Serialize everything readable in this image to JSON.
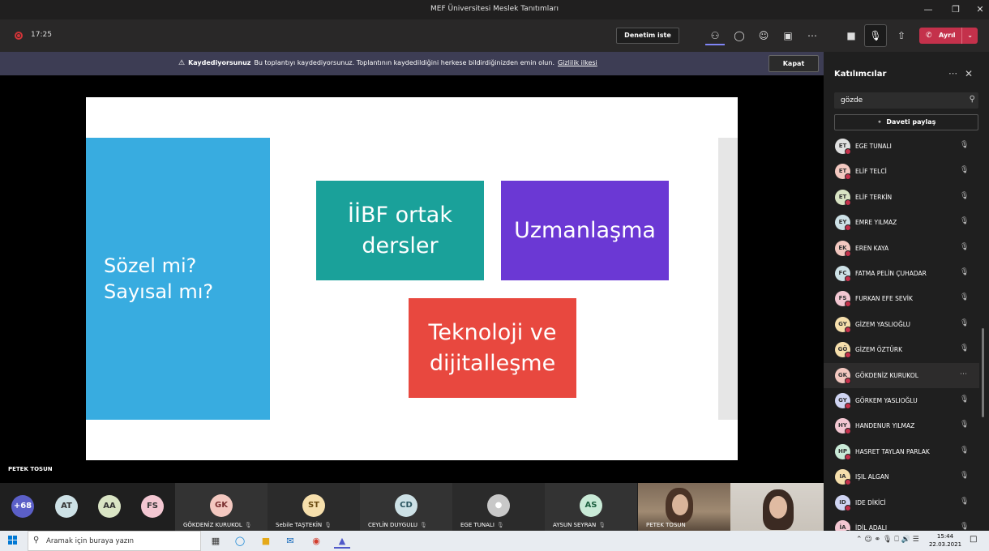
{
  "window": {
    "title": "MEF Üniversitesi Meslek Tanıtımları"
  },
  "toolbar": {
    "timer": "17:25",
    "request_control": "Denetim iste",
    "leave": "Ayrıl"
  },
  "banner": {
    "title": "Kaydediyorsunuz",
    "message": "Bu toplantıyı kaydediyorsunuz. Toplantının kaydedildiğini herkese bildirdiğinizden emin olun.",
    "link": "Gizlilik ilkesi",
    "close": "Kapat"
  },
  "slide": {
    "blue": "Sözel mi? Sayısal mı?",
    "teal": "İİBF ortak dersler",
    "purple": "Uzmanlaşma",
    "red": "Teknoloji ve dijitalleşme"
  },
  "presenter_name": "PETEK TOSUN",
  "strip": {
    "more_count": "+68",
    "avatars": [
      {
        "initials": "AT",
        "bg": "#cde1e6"
      },
      {
        "initials": "AA",
        "bg": "#d9e4c4"
      },
      {
        "initials": "FS",
        "bg": "#f3c7d2"
      }
    ],
    "tiles": [
      {
        "initials": "GK",
        "name": "GÖKDENİZ KURUKOL",
        "bg": "#f3c8c0"
      },
      {
        "initials": "ST",
        "name": "Sebile TAŞTEKİN",
        "bg": "#f6dfac"
      },
      {
        "initials": "CD",
        "name": "CEYLİN DUYGULU",
        "bg": "#cde1e6"
      },
      {
        "initials": "",
        "name": "EGE TUNALI",
        "bg": "#c8c8c8"
      },
      {
        "initials": "AS",
        "name": "AYSUN SEYRAN",
        "bg": "#c9ead7"
      }
    ],
    "video_name": "PETEK TOSUN"
  },
  "panel": {
    "title": "Katılımcılar",
    "search_value": "gözde",
    "share": "Daveti paylaş",
    "participants": [
      {
        "initials": "ET",
        "name": "EGE TUNALI",
        "bg": "#e0e0e0"
      },
      {
        "initials": "ET",
        "name": "ELİF TELCİ",
        "bg": "#f3c8c0"
      },
      {
        "initials": "ET",
        "name": "ELİF TERKİN",
        "bg": "#d9e4c4"
      },
      {
        "initials": "EY",
        "name": "EMRE YILMAZ",
        "bg": "#cde1e6"
      },
      {
        "initials": "EK",
        "name": "EREN KAYA",
        "bg": "#f3c8c0"
      },
      {
        "initials": "FC",
        "name": "FATMA PELİN ÇUHADAR",
        "bg": "#cde1e6"
      },
      {
        "initials": "FS",
        "name": "FURKAN EFE SEVİK",
        "bg": "#f3c7d2"
      },
      {
        "initials": "GY",
        "name": "GİZEM YASLIOĞLU",
        "bg": "#f6dfac"
      },
      {
        "initials": "GÖ",
        "name": "GİZEM ÖZTÜRK",
        "bg": "#f6dfac"
      },
      {
        "initials": "GK",
        "name": "GÖKDENİZ KURUKOL",
        "bg": "#f3c8c0"
      },
      {
        "initials": "GY",
        "name": "GÖRKEM YASLIOĞLU",
        "bg": "#cfd4f2"
      },
      {
        "initials": "HY",
        "name": "HANDENUR YILMAZ",
        "bg": "#f3c7d2"
      },
      {
        "initials": "HP",
        "name": "HASRET TAYLAN PARLAK",
        "bg": "#c9ead7"
      },
      {
        "initials": "IA",
        "name": "IŞIL ALGAN",
        "bg": "#f6dfac"
      },
      {
        "initials": "ID",
        "name": "IDE DİKİCİ",
        "bg": "#cfd4f2"
      },
      {
        "initials": "İA",
        "name": "İDİL ADALI",
        "bg": "#f3c7d2"
      }
    ]
  },
  "taskbar": {
    "search_placeholder": "Aramak için buraya yazın",
    "time": "15:44",
    "date": "22.03.2021"
  }
}
